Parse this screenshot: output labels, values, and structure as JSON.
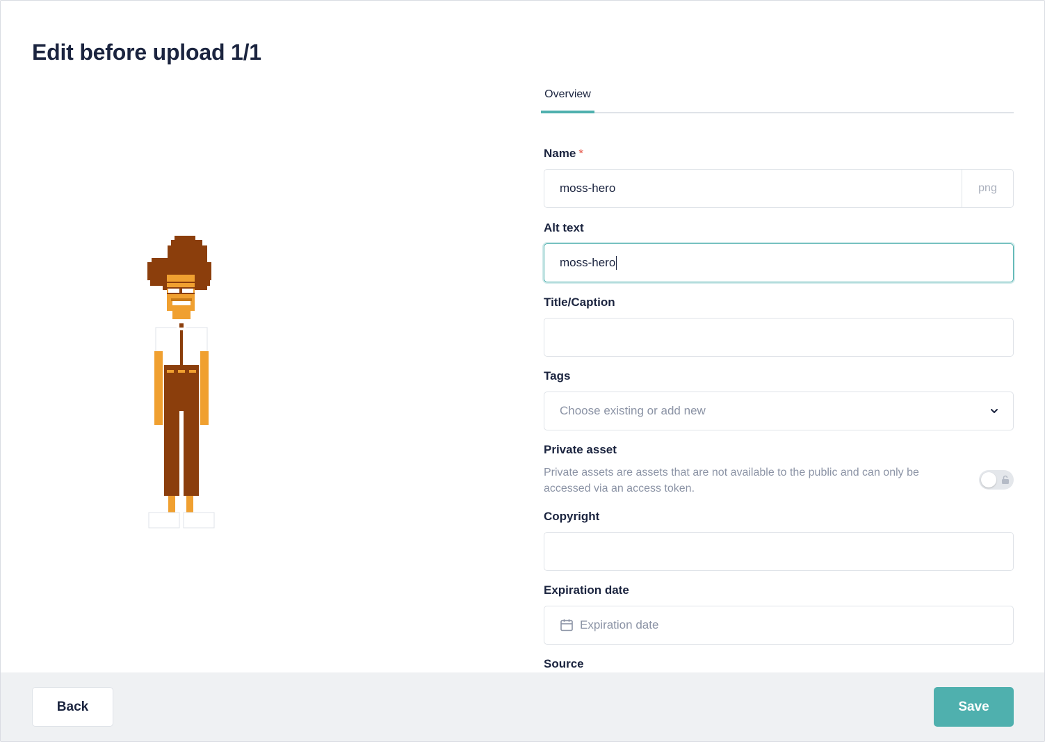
{
  "header": {
    "title": "Edit before upload 1/1"
  },
  "preview": {
    "image_alt": "moss-hero pixel character illustration"
  },
  "tabs": [
    {
      "label": "Overview"
    }
  ],
  "form": {
    "name": {
      "label": "Name",
      "required_mark": "*",
      "value": "moss-hero",
      "suffix": "png"
    },
    "alt_text": {
      "label": "Alt text",
      "value": "moss-hero"
    },
    "title_caption": {
      "label": "Title/Caption",
      "value": ""
    },
    "tags": {
      "label": "Tags",
      "placeholder": "Choose existing or add new"
    },
    "private_asset": {
      "label": "Private asset",
      "description": "Private assets are assets that are not available to the public and can only be accessed via an access token.",
      "enabled": false
    },
    "copyright": {
      "label": "Copyright",
      "value": ""
    },
    "expiration_date": {
      "label": "Expiration date",
      "placeholder": "Expiration date"
    },
    "source": {
      "label": "Source"
    }
  },
  "footer": {
    "back_label": "Back",
    "save_label": "Save"
  },
  "colors": {
    "accent": "#4fb0ae",
    "text": "#1b243f",
    "muted": "#8b93a5",
    "required": "#e5574a"
  }
}
